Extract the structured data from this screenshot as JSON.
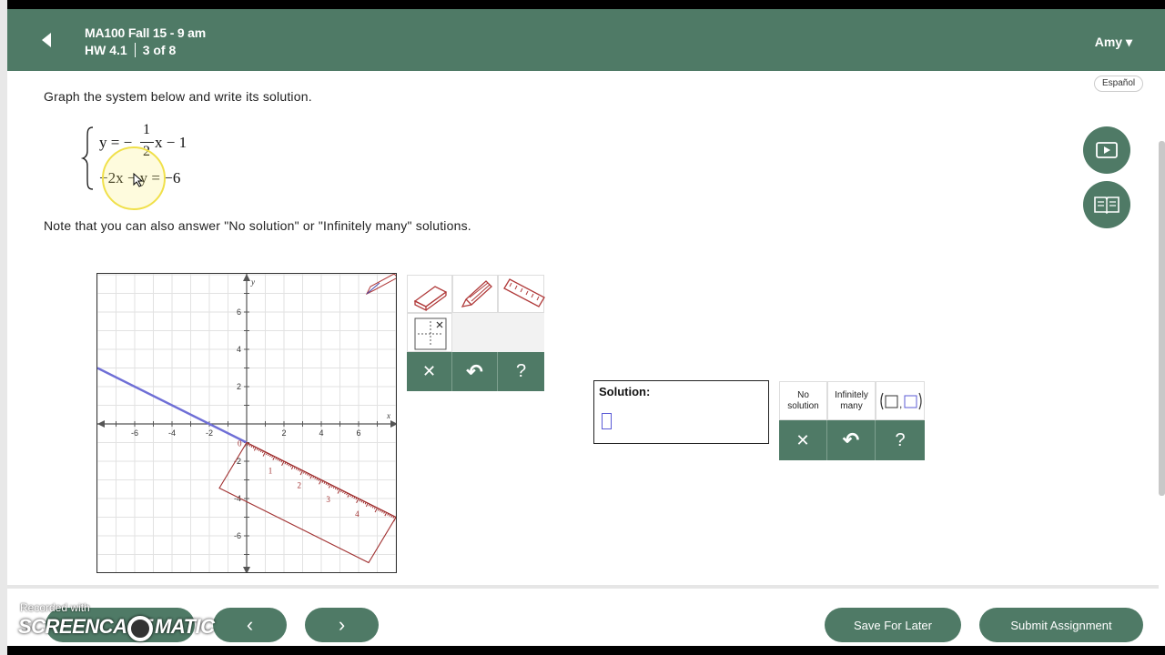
{
  "header": {
    "course": "MA100 Fall 15 - 9 am",
    "hw_name": "HW 4.1",
    "question_pos": "3 of 8",
    "user": "Amy ▾"
  },
  "problem": {
    "instruction": "Graph the system below and write its solution.",
    "eq1_lhs": "y = −",
    "eq1_num": "1",
    "eq1_den": "2",
    "eq1_rhs": "x − 1",
    "eq2": "−2x − y = −6",
    "note": "Note that you can also answer \"No solution\" or \"Infinitely many\" solutions."
  },
  "language_button": "Español",
  "graph": {
    "x_axis_label": "x",
    "y_axis_label": "y",
    "x_ticks": [
      "-6",
      "-4",
      "-2",
      "2",
      "4",
      "6"
    ],
    "y_ticks": [
      "6",
      "4",
      "2",
      "-2",
      "-4",
      "-6"
    ],
    "origin_label": "0",
    "ruler_marks": [
      "1",
      "2",
      "3",
      "4"
    ],
    "plotted_line": {
      "slope": -0.5,
      "intercept": -1,
      "color": "#6f6fd6"
    }
  },
  "graph_tools": {
    "clear_label": "✕",
    "undo_label": "↶",
    "help_label": "?"
  },
  "answer": {
    "solution_label": "Solution:",
    "no_solution": [
      "No",
      "solution"
    ],
    "infinitely_many": [
      "Infinitely",
      "many"
    ],
    "clear_label": "✕",
    "undo_label": "↶",
    "help_label": "?"
  },
  "footer": {
    "save_label": "Save For Later",
    "submit_label": "Submit Assignment",
    "prev_label": "‹",
    "next_label": "›"
  },
  "watermark": {
    "line1": "Recorded with",
    "line2": "SCREENCAST",
    "line3": "MATIC"
  },
  "colors": {
    "accent": "#4f7a66",
    "ruler": "#a03030",
    "line": "#6f6fd6"
  }
}
